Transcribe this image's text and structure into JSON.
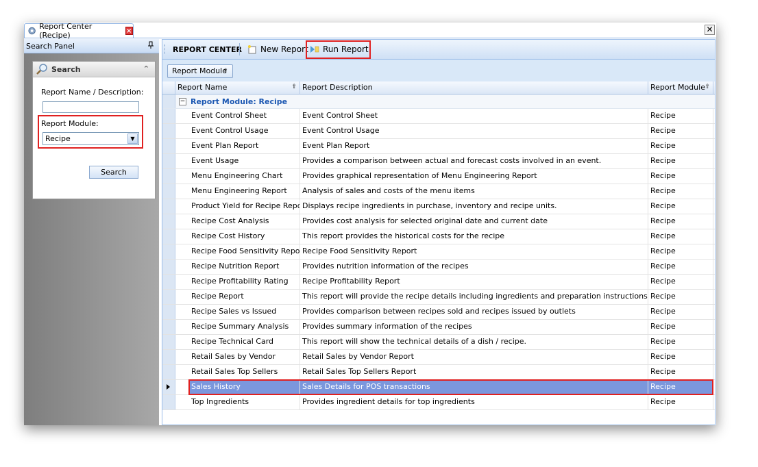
{
  "window": {
    "tab_label": "Report Center (Recipe)",
    "close_glyph": "✕"
  },
  "search_panel": {
    "header": "Search Panel",
    "box_title": "Search",
    "name_label": "Report Name / Description:",
    "name_value": "",
    "module_label": "Report Module:",
    "module_value": "Recipe",
    "search_button": "Search"
  },
  "toolbar": {
    "title": "REPORT CENTER",
    "new_report": "New Report",
    "run_report": "Run Report"
  },
  "group_chip": "Report Module",
  "columns": {
    "name": "Report Name",
    "description": "Report Description",
    "module": "Report Module"
  },
  "group_row": "Report Module: Recipe",
  "rows": [
    {
      "name": "Event Control Sheet",
      "description": "Event Control Sheet",
      "module": "Recipe"
    },
    {
      "name": "Event Control Usage",
      "description": "Event Control Usage",
      "module": "Recipe"
    },
    {
      "name": "Event Plan Report",
      "description": "Event Plan Report",
      "module": "Recipe"
    },
    {
      "name": "Event Usage",
      "description": "Provides a comparison between actual and forecast costs involved in an event.",
      "module": "Recipe"
    },
    {
      "name": "Menu Engineering Chart",
      "description": "Provides graphical representation of Menu Engineering Report",
      "module": "Recipe"
    },
    {
      "name": "Menu Engineering Report",
      "description": "Analysis of sales and costs of the menu items",
      "module": "Recipe"
    },
    {
      "name": "Product Yield for Recipe Report",
      "description": "Displays recipe ingredients in purchase, inventory and recipe units.",
      "module": "Recipe"
    },
    {
      "name": "Recipe Cost Analysis",
      "description": "Provides cost analysis for selected original date and current date",
      "module": "Recipe"
    },
    {
      "name": "Recipe Cost History",
      "description": "This report provides the historical costs for the recipe",
      "module": "Recipe"
    },
    {
      "name": "Recipe Food Sensitivity Report",
      "description": "Recipe Food Sensitivity Report",
      "module": "Recipe"
    },
    {
      "name": "Recipe Nutrition Report",
      "description": "Provides nutrition information of the recipes",
      "module": "Recipe"
    },
    {
      "name": "Recipe Profitability Rating",
      "description": "Recipe Profitability Report",
      "module": "Recipe"
    },
    {
      "name": "Recipe Report",
      "description": "This report will provide the recipe details including ingredients and preparation instructions",
      "module": "Recipe"
    },
    {
      "name": "Recipe Sales vs Issued",
      "description": "Provides comparison between recipes sold and recipes issued by outlets",
      "module": "Recipe"
    },
    {
      "name": "Recipe Summary Analysis",
      "description": "Provides summary information of the recipes",
      "module": "Recipe"
    },
    {
      "name": "Recipe Technical Card",
      "description": "This report will show the technical details of a dish / recipe.",
      "module": "Recipe"
    },
    {
      "name": "Retail Sales by Vendor",
      "description": "Retail Sales by Vendor Report",
      "module": "Recipe"
    },
    {
      "name": "Retail Sales Top Sellers",
      "description": "Retail Sales Top Sellers Report",
      "module": "Recipe"
    },
    {
      "name": "Sales History",
      "description": "Sales Details for POS transactions",
      "module": "Recipe",
      "selected": true
    },
    {
      "name": "Top Ingredients",
      "description": "Provides ingredient details for top ingredients",
      "module": "Recipe"
    }
  ],
  "colors": {
    "accent_border": "#99bbe8",
    "selected_row": "#7b97dd",
    "highlight_red": "#e02020",
    "group_text": "#1b57b2"
  }
}
